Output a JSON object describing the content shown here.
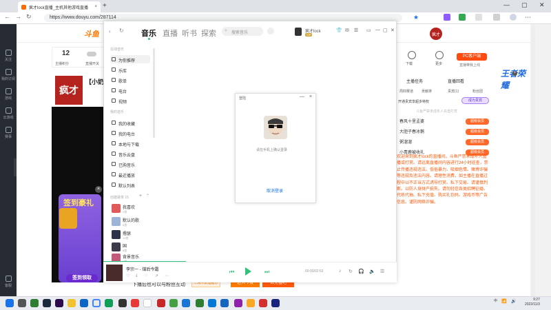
{
  "browser": {
    "tab_title": "疯才lock直播_主机其他游戏直播",
    "url": "https://www.douyu.com/287114",
    "new_tab": "+"
  },
  "douyu_sidebar": [
    {
      "label": "关注"
    },
    {
      "label": "我的订阅"
    },
    {
      "label": "游戏"
    },
    {
      "label": "云游戏"
    },
    {
      "label": "赛事"
    },
    {
      "label": "客服"
    }
  ],
  "douyu": {
    "logo": "斗鱼",
    "stat_num": "12",
    "stat_label": "主播积分",
    "stat_label2": "直播开关",
    "anchor_name": "疯才",
    "room_title": "【小奶狗",
    "promo_title": "签到豪礼",
    "promo_button": "签到领取",
    "gift_text": "下播后也可以与粉丝互动",
    "gift_btn1": "二两木数酒提示",
    "gift_btn2": "进入今夜",
    "gift_btn3": "去充值吧"
  },
  "room_panel": {
    "avatar": "疯才",
    "icons": [
      "下载",
      "更多"
    ],
    "pc_client": "PC客户端",
    "pc_sub": "直播带我上线",
    "main_tabs": [
      "主播任务",
      "直播回看"
    ],
    "sub_tabs": [
      "周四赛道",
      "贡献排",
      "贵宾(1)",
      "粉丝团"
    ],
    "vip_hint": "开通贵宾享超多特权",
    "vip_btn": "成为贵宾",
    "rank_hint": "斗鱼严禁未成年人充值打赏",
    "ranks": [
      {
        "name": "春风十里孟婆",
        "badge": "超级会员"
      },
      {
        "name": "大胆子春冰鹅",
        "badge": "超级会员"
      },
      {
        "name": "粥溜溜",
        "badge": "超级会员"
      },
      {
        "name": "小青鹿被收礼",
        "badge": "超级会员"
      }
    ],
    "notice": "欢迎来到疯才lock的直播间。斗鱼严禁未成年人直播或打赏。请远离直播间内容进行24小时巡查，禁止传播违规违法、低俗暴力、吸烟色情、赌博诈骗等违规及违法内容。请理性消费，如主播在直播过程中以不正当方式诱导打赏、私下交易、请谨慎判断。以防人身财产损失。请勿轻信各类招聘征婚、代练代抽、私下充值、购买礼包码、游戏币等广告信息。谨防网络诈骗。",
    "ad": "王者荣耀"
  },
  "music": {
    "tabs": [
      "音乐",
      "直播",
      "听书",
      "探索"
    ],
    "search_placeholder": "搜索音乐",
    "user_name": "疯才lock",
    "user_tag": "VIP",
    "section_online": "在线音乐",
    "online_items": [
      "为你推荐",
      "乐库",
      "歌单",
      "电台",
      "视频"
    ],
    "section_mine": "我的音乐",
    "mine_items": [
      "我的收藏",
      "我的电台",
      "本地与下载",
      "音乐云盘",
      "已购音乐",
      "最近播放",
      "默认列表"
    ],
    "section_created": "创建歌单 15",
    "playlists": [
      {
        "name": "我喜欢",
        "count": "2首"
      },
      {
        "name": "默认的歌",
        "count": "5首"
      },
      {
        "name": "撸瑟",
        "count": "12首"
      },
      {
        "name": "国",
        "count": "8首"
      },
      {
        "name": "背景音乐",
        "count": "6首"
      }
    ],
    "now_playing": "李宗一 - 煤后今霜",
    "time": "00:00/02:53"
  },
  "login_dialog": {
    "title": "登陆",
    "hint": "请在手机上确认登录",
    "cancel": "取消登录"
  },
  "taskbar": {
    "tray": "中",
    "time": "9:27",
    "date": "2022/11/3"
  },
  "colors": {
    "music_green": "#31c27c",
    "douyu_orange": "#ff7700",
    "notice_orange": "#ff5a0a"
  }
}
